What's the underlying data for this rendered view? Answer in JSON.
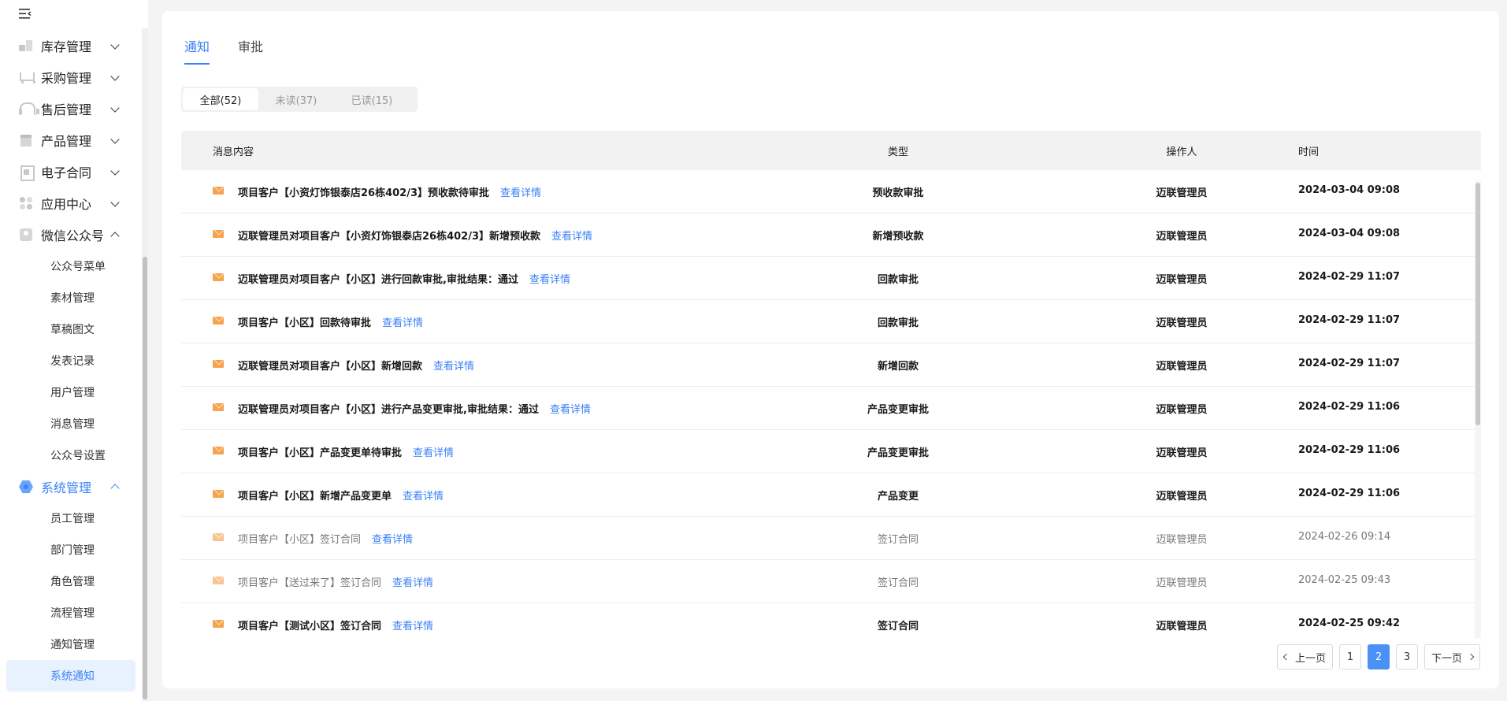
{
  "sidebar": {
    "groups": [
      {
        "label": "库存管理",
        "icon": "inventory-icon"
      },
      {
        "label": "采购管理",
        "icon": "cart-icon"
      },
      {
        "label": "售后管理",
        "icon": "headset-icon"
      },
      {
        "label": "产品管理",
        "icon": "product-icon"
      },
      {
        "label": "电子合同",
        "icon": "contract-icon"
      },
      {
        "label": "应用中心",
        "icon": "apps-icon"
      },
      {
        "label": "微信公众号",
        "icon": "wechat-user-icon"
      }
    ],
    "wechat_sub": [
      "公众号菜单",
      "素材管理",
      "草稿图文",
      "发表记录",
      "用户管理",
      "消息管理",
      "公众号设置"
    ],
    "system_label": "系统管理",
    "system_sub": [
      "员工管理",
      "部门管理",
      "角色管理",
      "流程管理",
      "通知管理",
      "系统通知"
    ]
  },
  "tabs": [
    "通知",
    "审批"
  ],
  "filters": [
    "全部(52)",
    "未读(37)",
    "已读(15)"
  ],
  "table": {
    "headers": {
      "msg": "消息内容",
      "type": "类型",
      "op": "操作人",
      "time": "时间"
    },
    "detail_label": "查看详情",
    "rows": [
      {
        "msg": "项目客户【小资灯饰银泰店26栋402/3】预收款待审批",
        "type": "预收款审批",
        "op": "迈联管理员",
        "time": "2024-03-04 09:08",
        "read": false
      },
      {
        "msg": "迈联管理员对项目客户【小资灯饰银泰店26栋402/3】新增预收款",
        "type": "新增预收款",
        "op": "迈联管理员",
        "time": "2024-03-04 09:08",
        "read": false
      },
      {
        "msg": "迈联管理员对项目客户【小区】进行回款审批,审批结果：通过",
        "type": "回款审批",
        "op": "迈联管理员",
        "time": "2024-02-29 11:07",
        "read": false
      },
      {
        "msg": "项目客户【小区】回款待审批",
        "type": "回款审批",
        "op": "迈联管理员",
        "time": "2024-02-29 11:07",
        "read": false
      },
      {
        "msg": "迈联管理员对项目客户【小区】新增回款",
        "type": "新增回款",
        "op": "迈联管理员",
        "time": "2024-02-29 11:07",
        "read": false
      },
      {
        "msg": "迈联管理员对项目客户【小区】进行产品变更审批,审批结果：通过",
        "type": "产品变更审批",
        "op": "迈联管理员",
        "time": "2024-02-29 11:06",
        "read": false
      },
      {
        "msg": "项目客户【小区】产品变更单待审批",
        "type": "产品变更审批",
        "op": "迈联管理员",
        "time": "2024-02-29 11:06",
        "read": false
      },
      {
        "msg": "项目客户【小区】新增产品变更单",
        "type": "产品变更",
        "op": "迈联管理员",
        "time": "2024-02-29 11:06",
        "read": false
      },
      {
        "msg": "项目客户【小区】签订合同",
        "type": "签订合同",
        "op": "迈联管理员",
        "time": "2024-02-26 09:14",
        "read": true
      },
      {
        "msg": "项目客户【送过来了】签订合同",
        "type": "签订合同",
        "op": "迈联管理员",
        "time": "2024-02-25 09:43",
        "read": true
      },
      {
        "msg": "项目客户【测试小区】签订合同",
        "type": "签订合同",
        "op": "迈联管理员",
        "time": "2024-02-25 09:42",
        "read": false
      }
    ]
  },
  "pagination": {
    "prev": "上一页",
    "next": "下一页",
    "pages": [
      "1",
      "2",
      "3"
    ],
    "current": "2"
  },
  "colors": {
    "accent": "#3b82f6",
    "mail": "#f6a24e"
  }
}
